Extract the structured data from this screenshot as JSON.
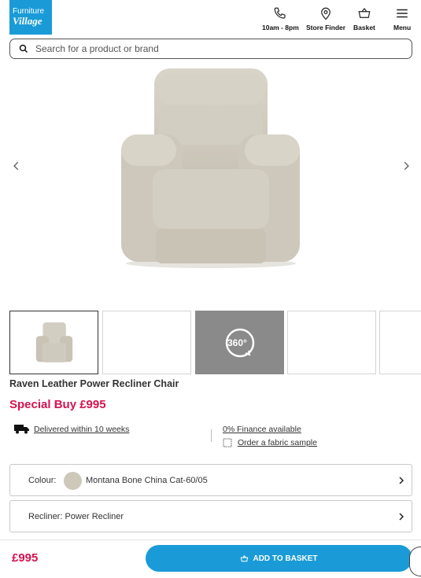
{
  "brand": {
    "line1": "Furniture",
    "line2": "Village"
  },
  "header": {
    "phone_label": "10am - 8pm",
    "store_label": "Store Finder",
    "basket_label": "Basket",
    "menu_label": "Menu"
  },
  "search": {
    "placeholder": "Search for a product or brand"
  },
  "product": {
    "name": "Raven Leather Power Recliner Chair",
    "price_line": "Special Buy £995"
  },
  "gallery": {
    "badge_360": "360°",
    "icons": [
      "chevron-left-icon",
      "chevron-right-icon"
    ]
  },
  "info": {
    "delivery": "Delivered within 10 weeks",
    "finance": "0% Finance available",
    "sample": "Order a fabric sample"
  },
  "options": {
    "colour_label": "Colour:",
    "colour_value": "Montana Bone China Cat-60/05",
    "recliner_text": "Recliner: Power Recliner"
  },
  "footer": {
    "price": "£995",
    "add_label": "ADD TO BASKET"
  },
  "colors": {
    "accent": "#1a9bd7",
    "price": "#d6124f",
    "swatch": "#cdc8ba"
  }
}
